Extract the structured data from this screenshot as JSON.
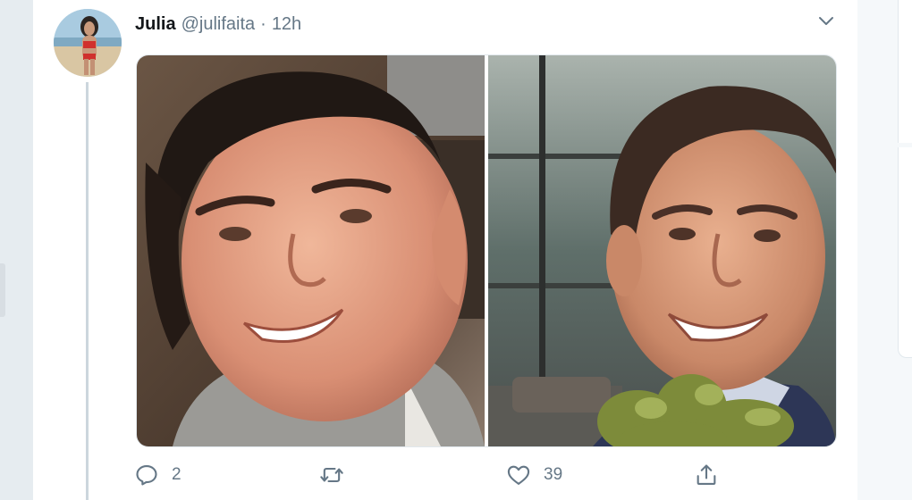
{
  "tweet": {
    "author_name": "Julia",
    "author_handle": "@julifaita",
    "separator": "·",
    "timestamp": "12h",
    "replies_count": "2",
    "likes_count": "39"
  },
  "icons": {
    "menu": "chevron-down-icon",
    "reply": "reply-icon",
    "retweet": "retweet-icon",
    "like": "heart-icon",
    "share": "share-icon"
  },
  "colors": {
    "icon_gray": "#657786",
    "text_dark": "#14171a",
    "thread_line": "#ccd6dd",
    "background": "#e6ecf0"
  }
}
